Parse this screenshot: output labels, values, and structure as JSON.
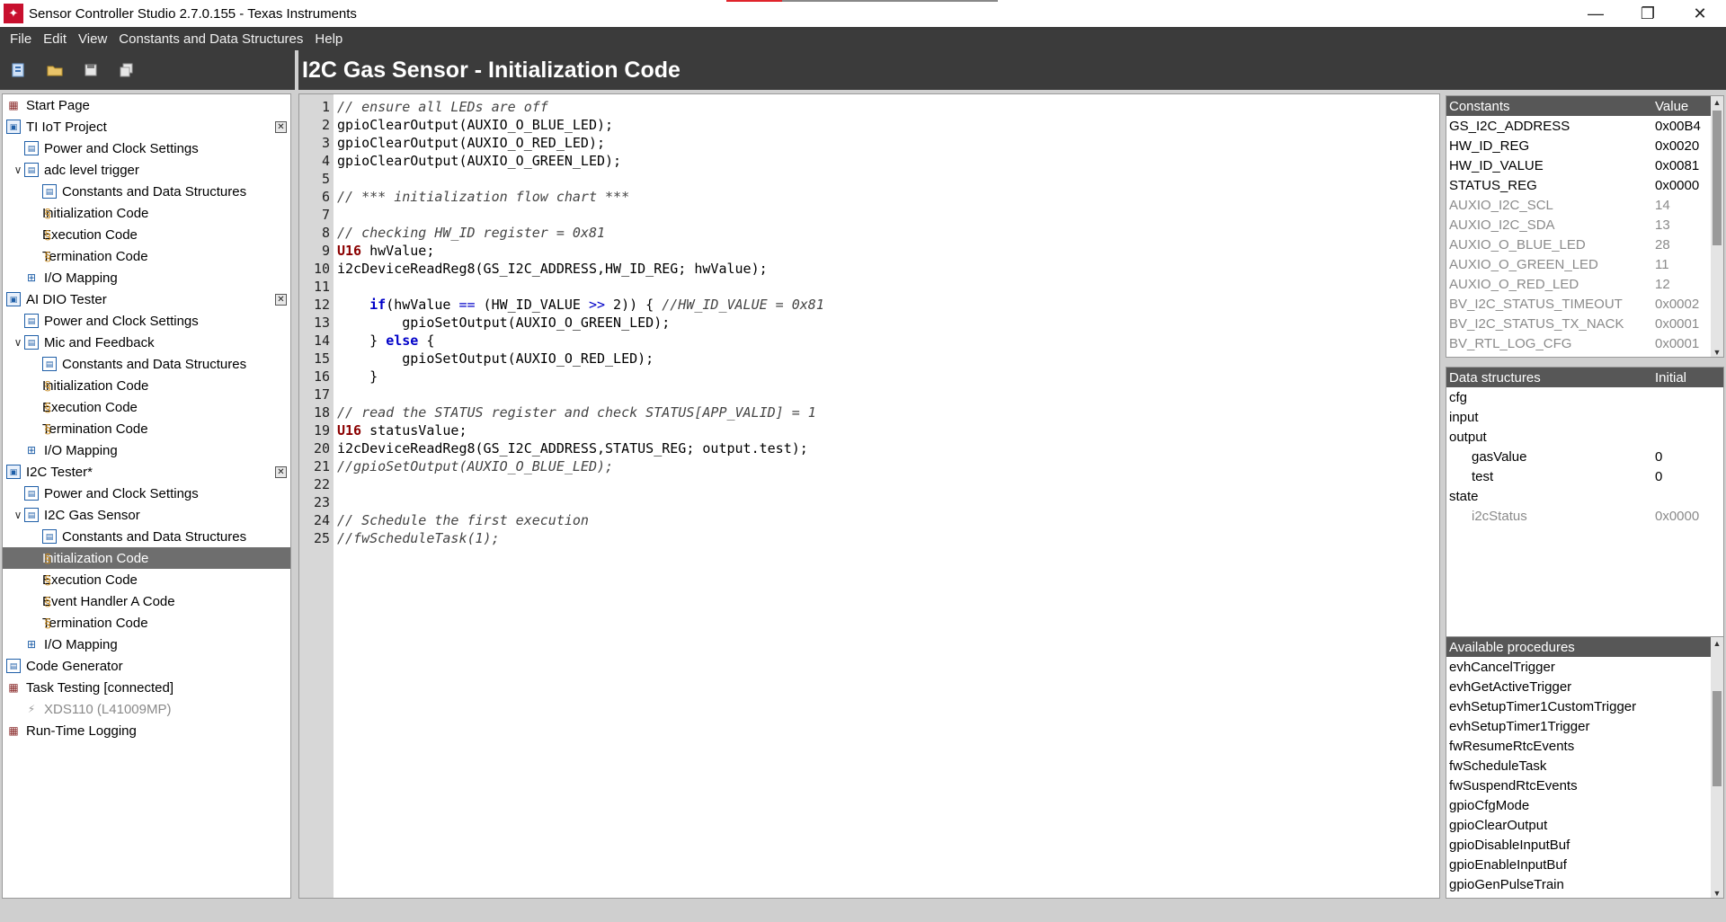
{
  "window": {
    "title": "Sensor Controller Studio 2.7.0.155 - Texas Instruments",
    "minimize": "—",
    "maximize": "❐",
    "close": "✕"
  },
  "menu": [
    "File",
    "Edit",
    "View",
    "Constants and Data Structures",
    "Help"
  ],
  "toolbar": {
    "icons": [
      "new-project-icon",
      "open-folder-icon",
      "save-icon",
      "save-all-icon"
    ]
  },
  "header": {
    "title": "I2C Gas Sensor - Initialization Code"
  },
  "tree": [
    {
      "label": "Start Page",
      "level": 0,
      "icon": "chart",
      "chev": ""
    },
    {
      "label": "TI IoT Project",
      "level": 0,
      "icon": "proj",
      "chev": "",
      "closable": true
    },
    {
      "label": "Power and Clock Settings",
      "level": 1,
      "icon": "doc",
      "chev": ""
    },
    {
      "label": "adc level trigger",
      "level": 1,
      "icon": "doc",
      "chev": "∨"
    },
    {
      "label": "Constants and Data Structures",
      "level": 2,
      "icon": "doc",
      "chev": ""
    },
    {
      "label": "Initialization Code",
      "level": 2,
      "icon": "code",
      "chev": ""
    },
    {
      "label": "Execution Code",
      "level": 2,
      "icon": "code",
      "chev": ""
    },
    {
      "label": "Termination Code",
      "level": 2,
      "icon": "code",
      "chev": ""
    },
    {
      "label": "I/O Mapping",
      "level": 1,
      "icon": "io",
      "chev": ""
    },
    {
      "label": "AI DIO Tester",
      "level": 0,
      "icon": "proj",
      "chev": "",
      "closable": true
    },
    {
      "label": "Power and Clock Settings",
      "level": 1,
      "icon": "doc",
      "chev": ""
    },
    {
      "label": "Mic and Feedback",
      "level": 1,
      "icon": "doc",
      "chev": "∨"
    },
    {
      "label": "Constants and Data Structures",
      "level": 2,
      "icon": "doc",
      "chev": ""
    },
    {
      "label": "Initialization Code",
      "level": 2,
      "icon": "code",
      "chev": ""
    },
    {
      "label": "Execution Code",
      "level": 2,
      "icon": "code",
      "chev": ""
    },
    {
      "label": "Termination Code",
      "level": 2,
      "icon": "code",
      "chev": ""
    },
    {
      "label": "I/O Mapping",
      "level": 1,
      "icon": "io",
      "chev": ""
    },
    {
      "label": "I2C Tester*",
      "level": 0,
      "icon": "proj",
      "chev": "",
      "closable": true
    },
    {
      "label": "Power and Clock Settings",
      "level": 1,
      "icon": "doc",
      "chev": ""
    },
    {
      "label": "I2C Gas Sensor",
      "level": 1,
      "icon": "doc",
      "chev": "∨"
    },
    {
      "label": "Constants and Data Structures",
      "level": 2,
      "icon": "doc",
      "chev": ""
    },
    {
      "label": "Initialization Code",
      "level": 2,
      "icon": "code",
      "chev": "",
      "selected": true
    },
    {
      "label": "Execution Code",
      "level": 2,
      "icon": "code",
      "chev": ""
    },
    {
      "label": "Event Handler A Code",
      "level": 2,
      "icon": "code",
      "chev": ""
    },
    {
      "label": "Termination Code",
      "level": 2,
      "icon": "code",
      "chev": ""
    },
    {
      "label": "I/O Mapping",
      "level": 1,
      "icon": "io",
      "chev": ""
    },
    {
      "label": "Code Generator",
      "level": 0,
      "icon": "doc",
      "chev": ""
    },
    {
      "label": "Task Testing [connected]",
      "level": 0,
      "icon": "chart",
      "chev": ""
    },
    {
      "label": "XDS110 (L41009MP)",
      "level": 1,
      "icon": "probe",
      "chev": "",
      "muted": true
    },
    {
      "label": "Run-Time Logging",
      "level": 0,
      "icon": "chart",
      "chev": ""
    }
  ],
  "code": [
    "// ensure all LEDs are off",
    "gpioClearOutput(AUXIO_O_BLUE_LED);",
    "gpioClearOutput(AUXIO_O_RED_LED);",
    "gpioClearOutput(AUXIO_O_GREEN_LED);",
    "",
    "// *** initialization flow chart ***",
    "",
    "// checking HW_ID register = 0x81",
    "U16 hwValue;",
    "i2cDeviceReadReg8(GS_I2C_ADDRESS,HW_ID_REG; hwValue);",
    "",
    "    if(hwValue == (HW_ID_VALUE >> 2)) { //HW_ID_VALUE = 0x81",
    "        gpioSetOutput(AUXIO_O_GREEN_LED);",
    "    } else {",
    "        gpioSetOutput(AUXIO_O_RED_LED);",
    "    }",
    "",
    "// read the STATUS register and check STATUS[APP_VALID] = 1",
    "U16 statusValue;",
    "i2cDeviceReadReg8(GS_I2C_ADDRESS,STATUS_REG; output.test);",
    "//gpioSetOutput(AUXIO_O_BLUE_LED);",
    "",
    "",
    "// Schedule the first execution",
    "//fwScheduleTask(1);"
  ],
  "constants": {
    "header_name": "Constants",
    "header_value": "Value",
    "rows": [
      {
        "name": "GS_I2C_ADDRESS",
        "value": "0x00B4",
        "dim": false
      },
      {
        "name": "HW_ID_REG",
        "value": "0x0020",
        "dim": false
      },
      {
        "name": "HW_ID_VALUE",
        "value": "0x0081",
        "dim": false
      },
      {
        "name": "STATUS_REG",
        "value": "0x0000",
        "dim": false
      },
      {
        "name": "AUXIO_I2C_SCL",
        "value": "14",
        "dim": true
      },
      {
        "name": "AUXIO_I2C_SDA",
        "value": "13",
        "dim": true
      },
      {
        "name": "AUXIO_O_BLUE_LED",
        "value": "28",
        "dim": true
      },
      {
        "name": "AUXIO_O_GREEN_LED",
        "value": "11",
        "dim": true
      },
      {
        "name": "AUXIO_O_RED_LED",
        "value": "12",
        "dim": true
      },
      {
        "name": "BV_I2C_STATUS_TIMEOUT",
        "value": "0x0002",
        "dim": true
      },
      {
        "name": "BV_I2C_STATUS_TX_NACK",
        "value": "0x0001",
        "dim": true
      },
      {
        "name": "BV_RTL_LOG_CFG",
        "value": "0x0001",
        "dim": true
      }
    ]
  },
  "data_structures": {
    "header_name": "Data structures",
    "header_value": "Initial",
    "rows": [
      {
        "name": "cfg",
        "value": "",
        "indent": false,
        "dim": false
      },
      {
        "name": "input",
        "value": "",
        "indent": false,
        "dim": false
      },
      {
        "name": "output",
        "value": "",
        "indent": false,
        "dim": false
      },
      {
        "name": "gasValue",
        "value": "0",
        "indent": true,
        "dim": false
      },
      {
        "name": "test",
        "value": "0",
        "indent": true,
        "dim": false
      },
      {
        "name": "state",
        "value": "",
        "indent": false,
        "dim": false
      },
      {
        "name": "i2cStatus",
        "value": "0x0000",
        "indent": true,
        "dim": true
      }
    ]
  },
  "procedures": {
    "header": "Available procedures",
    "rows": [
      "evhCancelTrigger",
      "evhGetActiveTrigger",
      "evhSetupTimer1CustomTrigger",
      "evhSetupTimer1Trigger",
      "fwResumeRtcEvents",
      "fwScheduleTask",
      "fwSuspendRtcEvents",
      "gpioCfgMode",
      "gpioClearOutput",
      "gpioDisableInputBuf",
      "gpioEnableInputBuf",
      "gpioGenPulseTrain"
    ]
  }
}
